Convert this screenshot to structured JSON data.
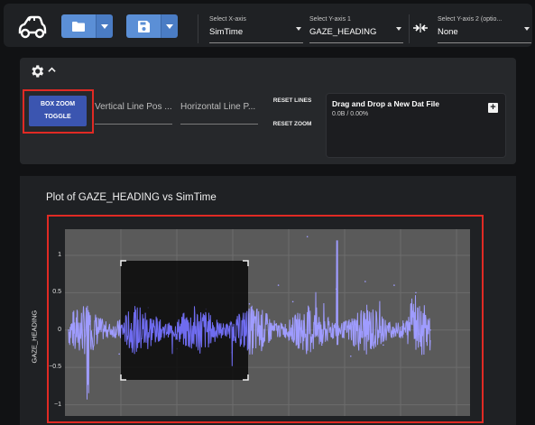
{
  "toolbar": {
    "x_axis": {
      "label": "Select X-axis",
      "value": "SimTime"
    },
    "y_axis_1": {
      "label": "Select Y-axis 1",
      "value": "GAZE_HEADING"
    },
    "y_axis_2": {
      "label": "Select Y-axis 2 (optio...",
      "value": "None"
    },
    "icons": [
      "car-icon",
      "folder-icon",
      "save-icon",
      "swap-axis-icon"
    ],
    "accent": "#5b8fd6"
  },
  "controls": {
    "box_zoom_label_line1": "BOX ZOOM",
    "box_zoom_label_line2": "TOGGLE",
    "vertical_line_placeholder": "Vertical Line Pos ...",
    "horizontal_line_placeholder": "Horizontal Line P...",
    "reset_lines": "RESET LINES",
    "reset_zoom": "RESET ZOOM",
    "drop_title": "Drag and Drop a New Dat File",
    "drop_status": "0.0B / 0.00%"
  },
  "plot": {
    "title": "Plot of GAZE_HEADING vs SimTime",
    "ylabel": "GAZE_HEADING"
  },
  "chart_data": {
    "type": "line",
    "title": "Plot of GAZE_HEADING vs SimTime",
    "xlabel": "",
    "ylabel": "GAZE_HEADING",
    "ylim": [
      -1.15,
      1.35
    ],
    "yticks": [
      "1",
      "0.5",
      "0",
      "−0.5",
      "−1"
    ],
    "grid": true,
    "series": [
      {
        "color": "#9f9cff",
        "x": [
          0,
          0.06,
          0.14,
          0.22,
          0.3,
          0.38,
          0.45,
          0.5,
          0.53,
          0.58,
          0.62,
          0.66,
          0.7,
          0.74,
          0.78,
          0.82,
          0.87,
          0.9,
          0.96,
          1.0
        ],
        "y": [
          0.0,
          0.12,
          -0.32,
          0.3,
          -0.25,
          0.28,
          -0.3,
          0.35,
          -0.1,
          0.6,
          0.38,
          1.25,
          -0.2,
          0.55,
          -0.35,
          0.65,
          -0.2,
          0.6,
          0.5,
          0.0
        ]
      }
    ],
    "x_extent": [
      0,
      1
    ]
  }
}
